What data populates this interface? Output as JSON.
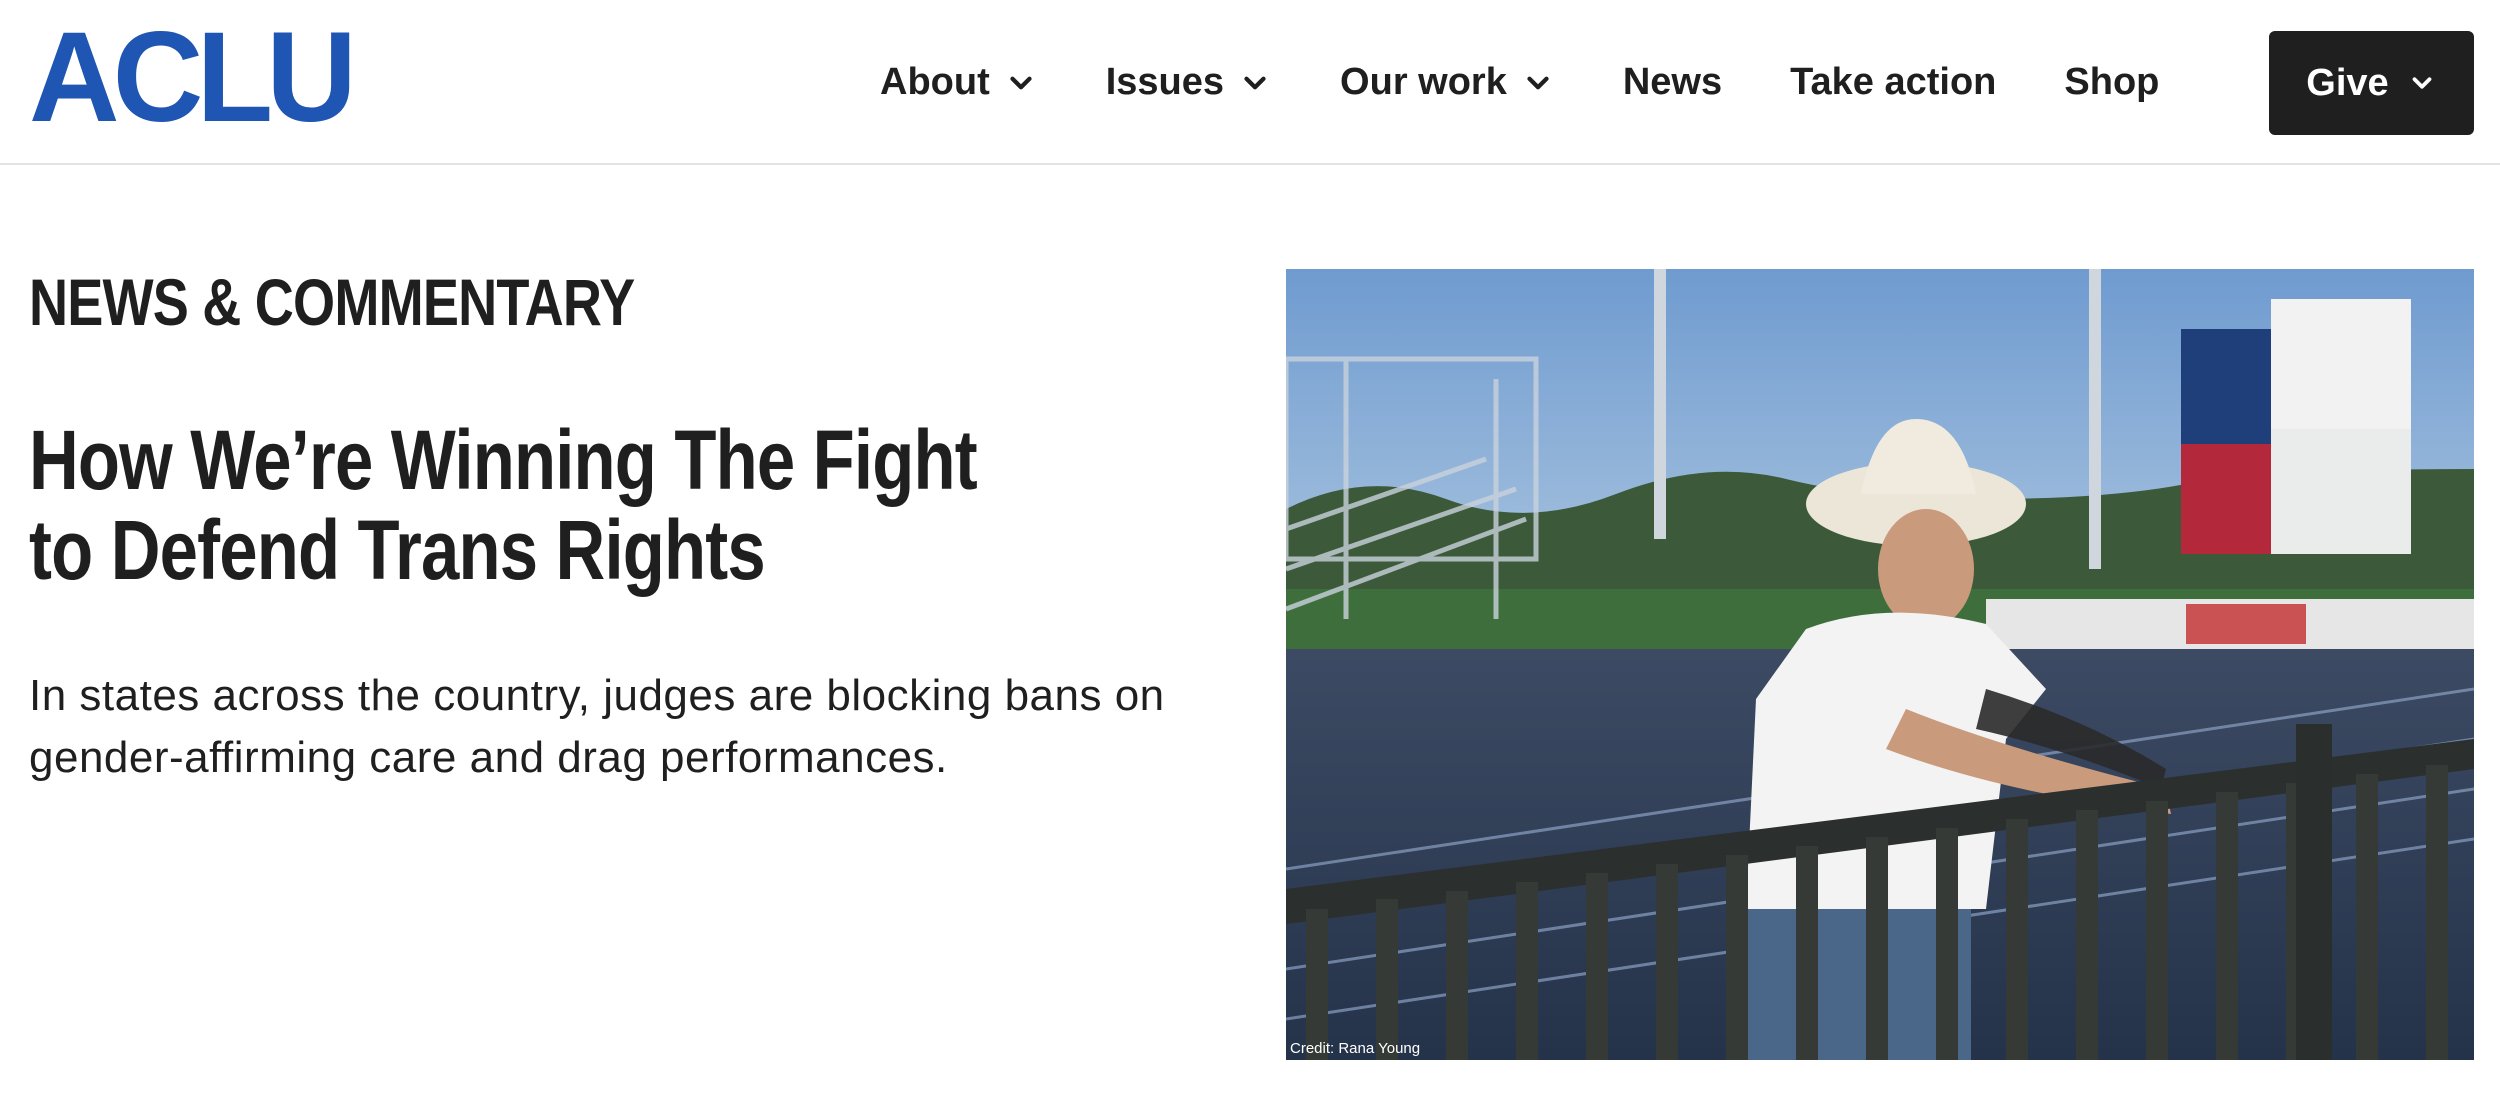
{
  "header": {
    "logo": "ACLU",
    "nav": [
      {
        "label": "About",
        "has_dropdown": true
      },
      {
        "label": "Issues",
        "has_dropdown": true
      },
      {
        "label": "Our work",
        "has_dropdown": true
      },
      {
        "label": "News",
        "has_dropdown": false
      },
      {
        "label": "Take action",
        "has_dropdown": false
      },
      {
        "label": "Shop",
        "has_dropdown": false
      }
    ],
    "give_label": "Give"
  },
  "main": {
    "section_label": "NEWS & COMMENTARY",
    "headline": "How We’re Winning The Fight to Defend Trans Rights",
    "subhead": "In states across the country, judges are blocking bans on gender-affirming care and drag performances.",
    "photo_credit": "Credit: Rana Young"
  },
  "colors": {
    "brand_blue": "#1f55b3",
    "text": "#1f1f1f",
    "give_button": "#1f1f1f"
  },
  "icons": {
    "dropdown": "chevron-down-icon"
  }
}
